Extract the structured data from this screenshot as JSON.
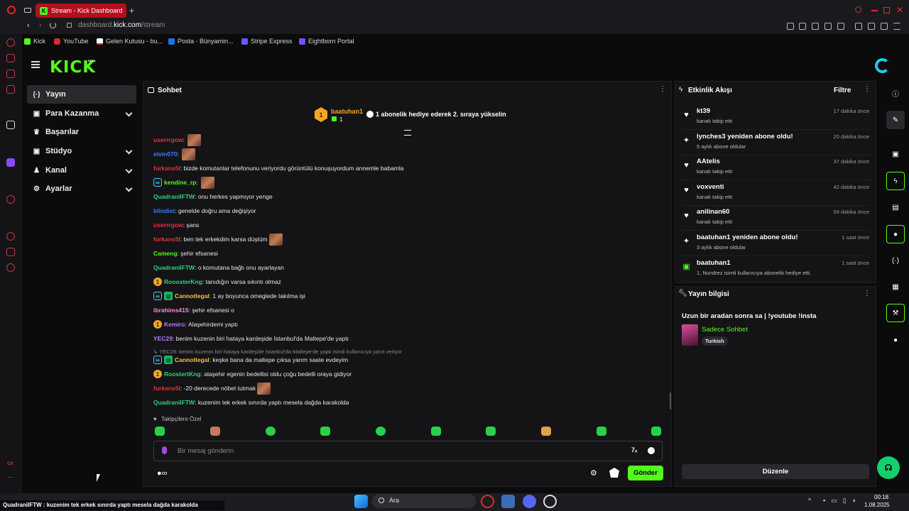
{
  "browser": {
    "tab_title": "Stream - Kick Dashboard",
    "new_tab_glyph": "+",
    "address_prefix": "dashboard.",
    "address_domain": "kick.com",
    "address_path": "/stream",
    "bookmarks": [
      "Kick",
      "YouTube",
      "Gelen Kutusu - bu...",
      "Posta - Bünyamin...",
      "Stripe Express",
      "Eightborn Portal"
    ]
  },
  "brand": {
    "logo": "KICK",
    "beta": "BETA",
    "accent": "#53fc18"
  },
  "nav": {
    "items": [
      {
        "label": "Yayın",
        "icon": "broadcast-icon"
      },
      {
        "label": "Para Kazanma",
        "icon": "dollar-icon"
      },
      {
        "label": "Başarılar",
        "icon": "trophy-icon"
      },
      {
        "label": "Stüdyo",
        "icon": "studio-icon"
      },
      {
        "label": "Kanal",
        "icon": "channel-icon"
      },
      {
        "label": "Ayarlar",
        "icon": "gear-icon"
      }
    ]
  },
  "chat": {
    "title": "Sohbet",
    "pinned_user": "baatuhan1",
    "pinned_count": "1",
    "pinned_rank": "1",
    "pinned_text": "1 abonelik hediye ederek 2. sıraya yükselin",
    "messages": [
      {
        "user": "userrrgow",
        "color": "#e0353b",
        "text": "",
        "emote": true,
        "badges": []
      },
      {
        "user": "elvin070",
        "color": "#3a7bff",
        "text": "",
        "emote": true,
        "badges": []
      },
      {
        "user": "furkans5l",
        "color": "#e0353b",
        "text": "bizde komutanlar telefonunu veriyordu görüntülü konuşuyordum annemle babamla",
        "emote": false,
        "badges": []
      },
      {
        "user": "kendine_rp",
        "color": "#53fc18",
        "text": "",
        "emote": true,
        "badges": [
          "c"
        ]
      },
      {
        "user": "QuadranilFTW",
        "color": "#2fd07b",
        "text": "onu herkes yapmıyor yenge",
        "emote": false,
        "badges": []
      },
      {
        "user": "blindist",
        "color": "#3a7bff",
        "text": "genelde doğru ama değişiyor",
        "emote": false,
        "badges": []
      },
      {
        "user": "userrrgow",
        "color": "#e0353b",
        "text": "şans",
        "emote": false,
        "badges": []
      },
      {
        "user": "furkans5l",
        "color": "#e0353b",
        "text": "ben tek erkekdim karsa düştüm",
        "emote": true,
        "badges": []
      },
      {
        "user": "Cameng",
        "color": "#53fc18",
        "text": "şehir efsanesi",
        "emote": false,
        "badges": []
      },
      {
        "user": "QuadranilFTW",
        "color": "#2fd07b",
        "text": "o komutana bağlı onu ayarlayan",
        "emote": false,
        "badges": []
      },
      {
        "user": "RooosterKng",
        "color": "#2fd07b",
        "text": "tanıdığın varsa sıkıntı olmaz",
        "emote": false,
        "badges": [
          "o"
        ]
      },
      {
        "user": "Cannotlegal",
        "color": "#f5c341",
        "text": "1 ay boyunca omeglede takılma işi",
        "emote": false,
        "badges": [
          "c",
          "g"
        ]
      },
      {
        "user": "ibrahims415",
        "color": "#f58ad4",
        "text": "şehir efsanesi o",
        "emote": false,
        "badges": []
      },
      {
        "user": "Kemiro",
        "color": "#b779ff",
        "text": "Alaşehirdemi yaptı",
        "emote": false,
        "badges": [
          "o"
        ]
      },
      {
        "user": "YEC29",
        "color": "#b779ff",
        "text": "benim kuzenin biri hataya kardeşide İstanbul'da Maltepe'de yaptı",
        "emote": false,
        "badges": []
      }
    ],
    "reply_context": "↳ YEC29: benim kuzenin biri hataya kardeşide İstanbul'da Maltepe'de yaptı isimli kullanıcıya yanıt veriyor",
    "messages2": [
      {
        "user": "Cannotlegal",
        "color": "#f5c341",
        "text": "keşke bana da maltepe çıksa yarım saate evdeyim",
        "emote": false,
        "badges": [
          "c",
          "g"
        ]
      },
      {
        "user": "RoostertKng",
        "color": "#2fd07b",
        "text": "alaşehir egenin bedellisi oldu çoğu bedelli oraya gidiyor",
        "emote": false,
        "badges": [
          "o"
        ]
      },
      {
        "user": "furkans5l",
        "color": "#e0353b",
        "text": "-20 derecede nöbet tutmak",
        "emote": true,
        "badges": []
      },
      {
        "user": "QuadranilFTW",
        "color": "#2fd07b",
        "text": "kuzenim tek erkek sınırda yaptı mesela dağda karakolda",
        "emote": false,
        "badges": []
      }
    ],
    "followers_only": "Takipçilere Özel",
    "input_placeholder": "Bir mesaj gönderin",
    "send_label": "Gönder"
  },
  "activity": {
    "title": "Etkinlik Akışı",
    "filter_label": "Filtre",
    "items": [
      {
        "name": "kt39",
        "sub": "kanalı takip etti",
        "time": "17 dakika önce",
        "icon": "heart-icon"
      },
      {
        "name": "lynches3 yeniden abone oldu!",
        "sub": "5 aylık abone oldular",
        "time": "20 dakika önce",
        "icon": "sparkle-icon"
      },
      {
        "name": "AAtelis",
        "sub": "kanalı takip etti",
        "time": "37 dakika önce",
        "icon": "heart-icon"
      },
      {
        "name": "voxventi",
        "sub": "kanalı takip etti",
        "time": "42 dakika önce",
        "icon": "heart-icon"
      },
      {
        "name": "anilinan60",
        "sub": "kanalı takip etti",
        "time": "58 dakika önce",
        "icon": "heart-icon"
      },
      {
        "name": "baatuhan1 yeniden abone oldu!",
        "sub": "3 aylık abone oldular",
        "time": "1 saat önce",
        "icon": "sparkle-icon"
      },
      {
        "name": "baatuhan1",
        "sub": "1, Nundrez isimli kullanıcıya abonelik hediye etti.",
        "time": "1 saat önce",
        "icon": "gift-icon"
      }
    ]
  },
  "stream_info": {
    "title": "Yayın bilgisi",
    "stream_title": "Uzun bir aradan sonra sa | !youtube !insta",
    "category": "Sadece Sohbet",
    "tag": "Turkish",
    "edit_label": "Düzenle"
  },
  "ticker": "QuadranilFTW : kuzenim tek erkek sınırda yaptı mesela dağda karakolda",
  "taskbar": {
    "search": "Ara",
    "time": "00:18",
    "date": "1.08.2025"
  }
}
